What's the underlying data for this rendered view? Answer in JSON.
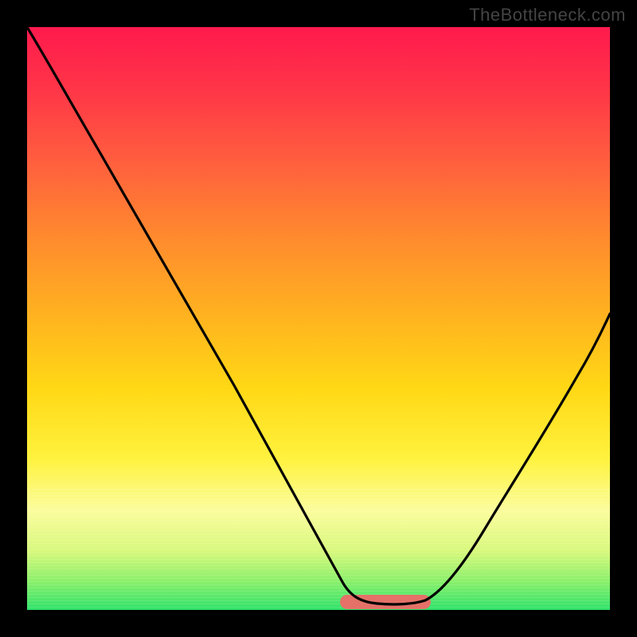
{
  "watermark": "TheBottleneck.com",
  "chart_data": {
    "type": "line",
    "title": "",
    "xlabel": "",
    "ylabel": "",
    "xlim": [
      0,
      100
    ],
    "ylim": [
      0,
      100
    ],
    "optimum_x_range": [
      55,
      68
    ],
    "series": [
      {
        "name": "bottleneck-curve",
        "x": [
          0,
          5,
          10,
          15,
          20,
          25,
          30,
          35,
          40,
          45,
          50,
          55,
          58,
          60,
          62,
          64,
          66,
          68,
          72,
          76,
          80,
          84,
          88,
          92,
          96,
          100
        ],
        "y": [
          100,
          92,
          84,
          76,
          68,
          60,
          52,
          43,
          35,
          26,
          17,
          7,
          3,
          1,
          0,
          0,
          0,
          1,
          5,
          12,
          20,
          29,
          38,
          47,
          55,
          63
        ]
      }
    ],
    "annotations": {
      "trough_marker_color": "#e57168"
    },
    "background": {
      "type": "vertical-gradient",
      "stops": [
        {
          "pos": 0.0,
          "color": "#ff1a4d"
        },
        {
          "pos": 0.5,
          "color": "#ffb41f"
        },
        {
          "pos": 0.74,
          "color": "#fff23e"
        },
        {
          "pos": 1.0,
          "color": "#2fe26b"
        }
      ]
    }
  }
}
